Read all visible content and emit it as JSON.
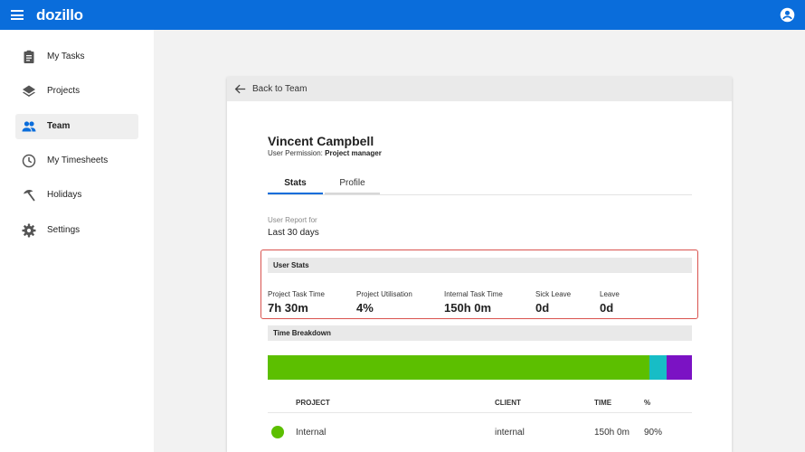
{
  "app": {
    "name": "dozillo",
    "brand_color": "#0a6ddb"
  },
  "topbar": {
    "menu_icon": "hamburger-icon",
    "account_icon": "account-circle-icon"
  },
  "sidebar": {
    "items": [
      {
        "label": "My Tasks",
        "icon": "clipboard-icon",
        "active": false
      },
      {
        "label": "Projects",
        "icon": "layers-icon",
        "active": false
      },
      {
        "label": "Team",
        "icon": "people-icon",
        "active": true
      },
      {
        "label": "My Timesheets",
        "icon": "clock-icon",
        "active": false
      },
      {
        "label": "Holidays",
        "icon": "beach-umbrella-icon",
        "active": false
      },
      {
        "label": "Settings",
        "icon": "gear-icon",
        "active": false
      }
    ]
  },
  "card": {
    "back_label": "Back to Team",
    "user_name": "Vincent Campbell",
    "permission_prefix": "User Permission:",
    "permission_value": "Project manager",
    "tabs": [
      {
        "label": "Stats",
        "active": true
      },
      {
        "label": "Profile",
        "active": false
      }
    ],
    "report_for_label": "User Report for",
    "report_range": "Last 30 days",
    "user_stats": {
      "title": "User Stats",
      "items": [
        {
          "label": "Project Task Time",
          "value": "7h 30m"
        },
        {
          "label": "Project Utilisation",
          "value": "4%"
        },
        {
          "label": "Internal Task Time",
          "value": "150h 0m"
        },
        {
          "label": "Sick Leave",
          "value": "0d"
        },
        {
          "label": "Leave",
          "value": "0d"
        }
      ]
    },
    "time_breakdown": {
      "title": "Time Breakdown",
      "segments": [
        {
          "share": 90,
          "color": "#5cbf00"
        },
        {
          "share": 4,
          "color": "#17bdc6"
        },
        {
          "share": 6,
          "color": "#7b12c4"
        }
      ]
    },
    "table": {
      "columns": [
        "PROJECT",
        "CLIENT",
        "TIME",
        "%"
      ],
      "rows": [
        {
          "project": "Internal",
          "client": "internal",
          "time": "150h 0m",
          "percent": "90%",
          "color": "#5cbf00"
        }
      ]
    }
  }
}
